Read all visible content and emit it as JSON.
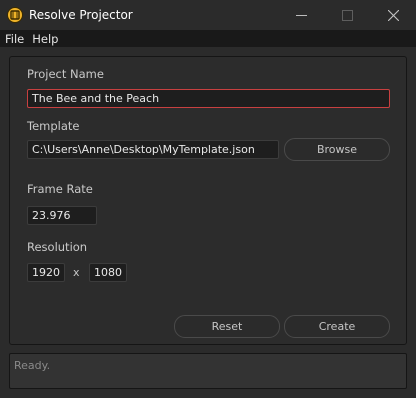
{
  "window": {
    "title": "Resolve Projector",
    "icon": "resolve-projector-app-icon",
    "controls": {
      "minimize_icon": "minimize-icon",
      "maximize_icon": "maximize-icon",
      "close_icon": "close-icon"
    }
  },
  "menu": {
    "items": [
      {
        "label": "File"
      },
      {
        "label": "Help"
      }
    ]
  },
  "form": {
    "project_name": {
      "label": "Project Name",
      "value": "The Bee and the Peach"
    },
    "template": {
      "label": "Template",
      "value": "C:\\Users\\Anne\\Desktop\\MyTemplate.json",
      "browse_label": "Browse"
    },
    "frame_rate": {
      "label": "Frame Rate",
      "value": "23.976"
    },
    "resolution": {
      "label": "Resolution",
      "width": "1920",
      "separator": "x",
      "height": "1080"
    },
    "reset_label": "Reset",
    "create_label": "Create"
  },
  "status": {
    "text": "Ready."
  },
  "colors": {
    "focus_border": "#c84040",
    "app_icon": "#f0b429",
    "background": "#2b2b2b"
  }
}
